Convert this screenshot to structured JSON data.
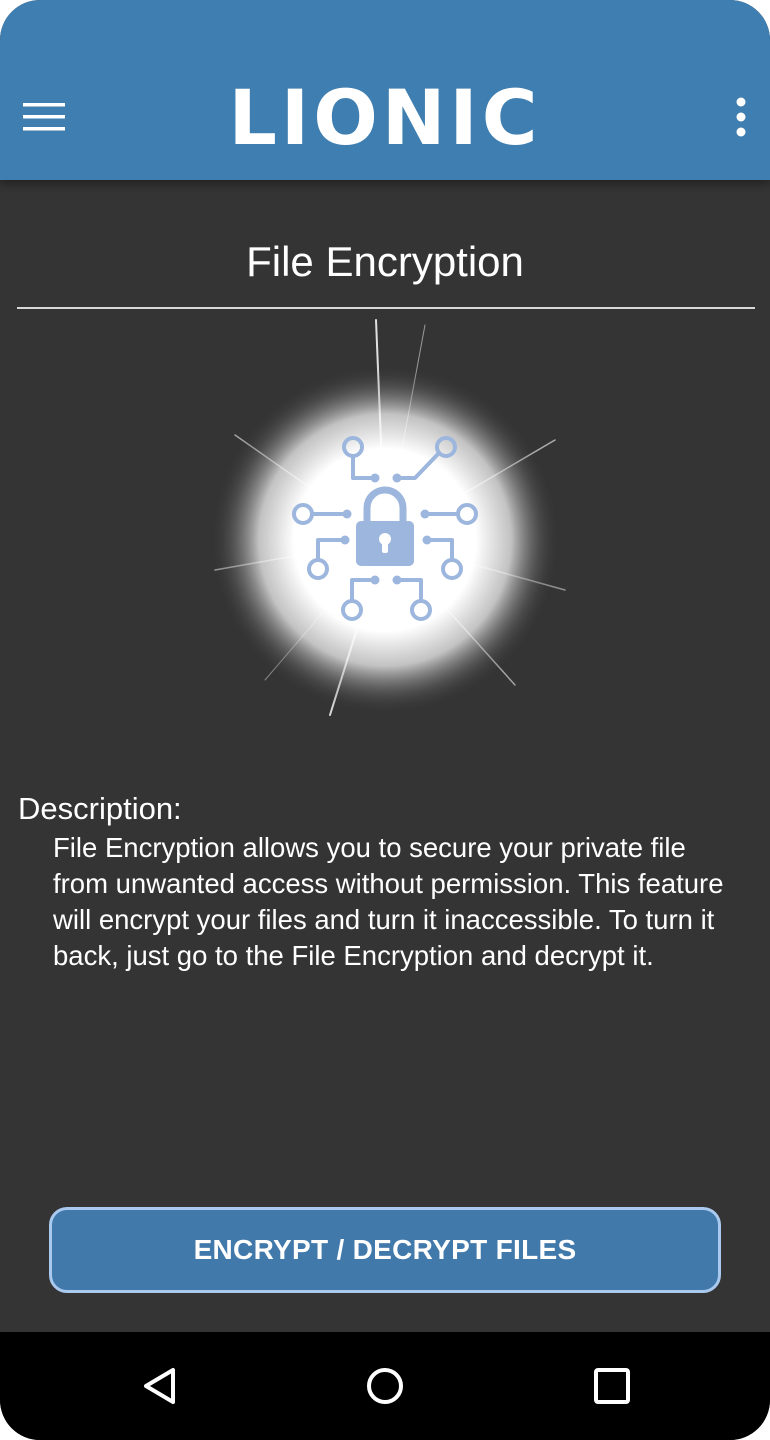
{
  "app": {
    "brand": "LIONIC",
    "accent_color": "#3f7eb0",
    "background_color": "#343434"
  },
  "appbar": {
    "menu_icon": "hamburger-menu-icon",
    "more_icon": "more-vertical-icon"
  },
  "page": {
    "title": "File Encryption",
    "hero_icon": "circuit-lock-icon",
    "description_label": "Description:",
    "description_text": "File Encryption allows you to secure your private file from unwanted access without permission. This feature will encrypt your files and turn it inaccessible. To turn it back, just go to the File Encryption and decrypt it."
  },
  "action": {
    "label": "ENCRYPT / DECRYPT FILES",
    "color": "#4279ab",
    "border_color": "#a9c9ee"
  },
  "navbar": {
    "back_icon": "back-triangle-icon",
    "home_icon": "home-circle-icon",
    "recents_icon": "recents-square-icon"
  }
}
